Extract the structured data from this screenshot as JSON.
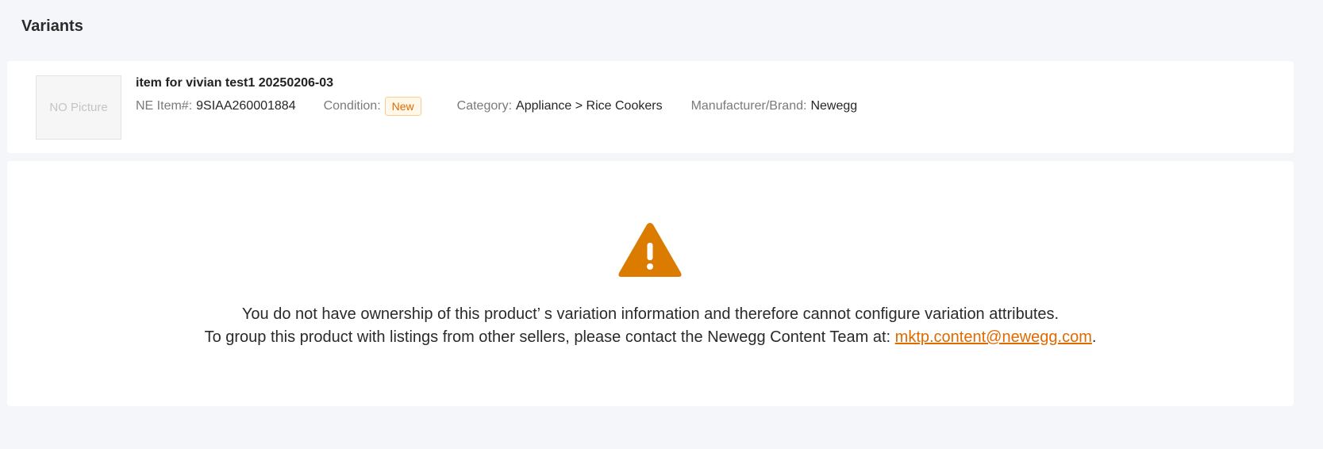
{
  "page": {
    "title": "Variants"
  },
  "product": {
    "thumbnail_text": "NO Picture",
    "name": "item for vivian test1 20250206-03",
    "ne_item_label": "NE Item#:",
    "ne_item_value": "9SIAA260001884",
    "condition_label": "Condition:",
    "condition_value": "New",
    "category_label": "Category:",
    "category_value": "Appliance > Rice Cookers",
    "brand_label": "Manufacturer/Brand:",
    "brand_value": "Newegg"
  },
  "notice": {
    "icon": "warning-triangle-icon",
    "line1": "You do not have ownership of this product’ s variation information and therefore cannot configure variation attributes.",
    "line2_prefix": "To group this product with listings from other sellers, please contact the Newegg Content Team at: ",
    "email": "mktp.content@newegg.com",
    "line2_suffix": "."
  },
  "colors": {
    "accent": "#e06a00",
    "warning_icon": "#db7b00",
    "background": "#f5f6fa"
  }
}
